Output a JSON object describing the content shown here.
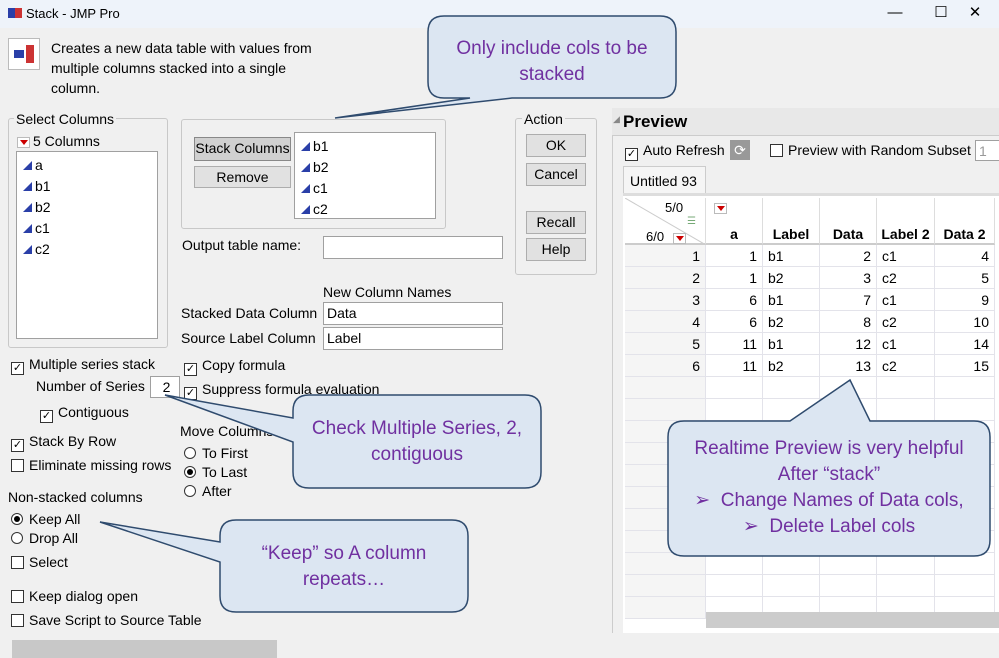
{
  "window": {
    "title": "Stack - JMP Pro",
    "minimize": "—",
    "maximize": "☐",
    "close": "✕"
  },
  "description": "Creates a new data table with values from multiple columns stacked into a single column.",
  "select_columns": {
    "title": "Select Columns",
    "count": "5 Columns",
    "items": [
      "a",
      "b1",
      "b2",
      "c1",
      "c2"
    ]
  },
  "stack": {
    "stack_button": "Stack Columns",
    "remove_button": "Remove",
    "items": [
      "b1",
      "b2",
      "c1",
      "c2"
    ]
  },
  "output": {
    "label": "Output table name:",
    "value": ""
  },
  "new_column_names": {
    "title": "New Column Names",
    "stacked_label": "Stacked Data Column",
    "stacked_value": "Data",
    "source_label": "Source Label Column",
    "source_value": "Label"
  },
  "action": {
    "title": "Action",
    "ok": "OK",
    "cancel": "Cancel",
    "recall": "Recall",
    "help": "Help"
  },
  "options": {
    "multiple_series": "Multiple series stack",
    "number_of_series_label": "Number of Series",
    "number_of_series": "2",
    "contiguous": "Contiguous",
    "copy_formula": "Copy formula",
    "suppress": "Suppress formula evaluation",
    "stack_by_row": "Stack By Row",
    "eliminate_missing": "Eliminate missing rows",
    "move_columns": "Move Columns",
    "to_first": "To First",
    "to_last": "To Last",
    "after": "After",
    "non_stacked": "Non-stacked columns",
    "keep_all": "Keep All",
    "drop_all": "Drop All",
    "select": "Select",
    "keep_dialog": "Keep dialog open",
    "save_script": "Save Script to Source Table"
  },
  "preview": {
    "title": "Preview",
    "auto_refresh": "Auto Refresh",
    "random_subset": "Preview with Random Subset",
    "subset_value": "1",
    "tab": "Untitled 93",
    "cols_count": "5/0",
    "rows_count": "6/0",
    "headers": [
      "a",
      "Label",
      "Data",
      "Label 2",
      "Data 2"
    ],
    "rows": [
      [
        "1",
        "1",
        "b1",
        "2",
        "c1",
        "4"
      ],
      [
        "2",
        "1",
        "b2",
        "3",
        "c2",
        "5"
      ],
      [
        "3",
        "6",
        "b1",
        "7",
        "c1",
        "9"
      ],
      [
        "4",
        "6",
        "b2",
        "8",
        "c2",
        "10"
      ],
      [
        "5",
        "11",
        "b1",
        "12",
        "c1",
        "14"
      ],
      [
        "6",
        "11",
        "b2",
        "13",
        "c2",
        "15"
      ]
    ]
  },
  "callouts": {
    "c1": "Only include cols to be stacked",
    "c2": "Check Multiple Series, 2, contiguous",
    "c3": "“Keep” so A column repeats…",
    "c4_line1": "Realtime Preview is very helpful",
    "c4_line2": "After “stack”",
    "c4_bullet1": "Change Names of Data cols,",
    "c4_bullet2": "Delete Label cols"
  },
  "colors": {
    "callout_fill": "#dce6f2",
    "callout_border": "#2f4b6e",
    "callout_text": "#7030a0"
  }
}
